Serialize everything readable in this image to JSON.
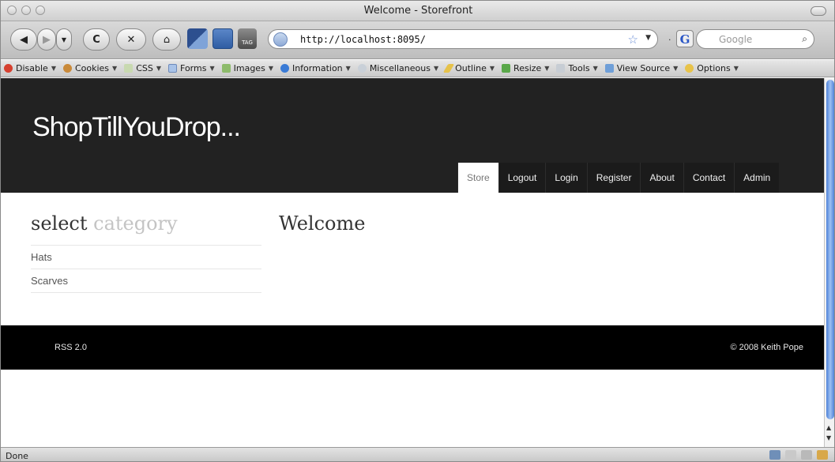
{
  "window": {
    "title": "Welcome - Storefront"
  },
  "toolbar": {
    "url": "http://localhost:8095/",
    "search_placeholder": "Google"
  },
  "devbar": {
    "items": [
      {
        "label": "Disable",
        "icon": "no-entry-icon"
      },
      {
        "label": "Cookies",
        "icon": "cookie-icon"
      },
      {
        "label": "CSS",
        "icon": "css-icon"
      },
      {
        "label": "Forms",
        "icon": "forms-icon"
      },
      {
        "label": "Images",
        "icon": "image-icon"
      },
      {
        "label": "Information",
        "icon": "info-icon"
      },
      {
        "label": "Miscellaneous",
        "icon": "misc-icon"
      },
      {
        "label": "Outline",
        "icon": "pencil-icon"
      },
      {
        "label": "Resize",
        "icon": "resize-icon"
      },
      {
        "label": "Tools",
        "icon": "wrench-icon"
      },
      {
        "label": "View Source",
        "icon": "source-icon"
      },
      {
        "label": "Options",
        "icon": "options-icon"
      }
    ]
  },
  "site": {
    "logo": "ShopTillYouDrop...",
    "menu": [
      "Store",
      "Logout",
      "Login",
      "Register",
      "About",
      "Contact",
      "Admin"
    ],
    "active_menu": "Store",
    "sidebar": {
      "title_dark": "select",
      "title_light": "category",
      "categories": [
        "Hats",
        "Scarves"
      ]
    },
    "main": {
      "heading": "Welcome"
    },
    "footer": {
      "rss": "RSS 2.0",
      "copyright": "© 2008 Keith Pope"
    }
  },
  "statusbar": {
    "text": "Done"
  },
  "colors": {
    "header_bg": "#222222",
    "footer_bg": "#000000",
    "scrollbar": "#4f82d8"
  }
}
